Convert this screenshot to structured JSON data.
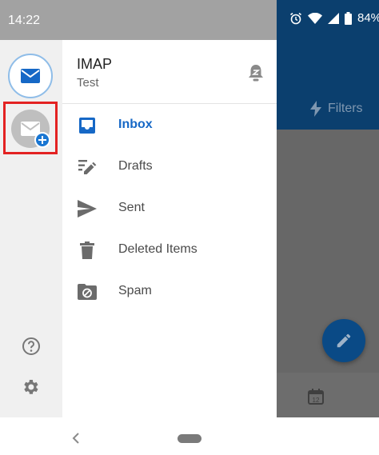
{
  "status_bar": {
    "time": "14:22",
    "battery": "84%"
  },
  "account": {
    "name": "IMAP",
    "subtitle": "Test"
  },
  "folders": [
    {
      "label": "Inbox",
      "icon": "inbox-icon",
      "active": true
    },
    {
      "label": "Drafts",
      "icon": "drafts-icon",
      "active": false
    },
    {
      "label": "Sent",
      "icon": "send-icon",
      "active": false
    },
    {
      "label": "Deleted Items",
      "icon": "trash-icon",
      "active": false
    },
    {
      "label": "Spam",
      "icon": "spam-folder-icon",
      "active": false
    }
  ],
  "background": {
    "filters_label": "Filters",
    "calendar_day": "12"
  },
  "colors": {
    "accent": "#1668c6",
    "header": "#0b3f6e",
    "highlight_border": "#e32222",
    "fab": "#0a4a86"
  }
}
